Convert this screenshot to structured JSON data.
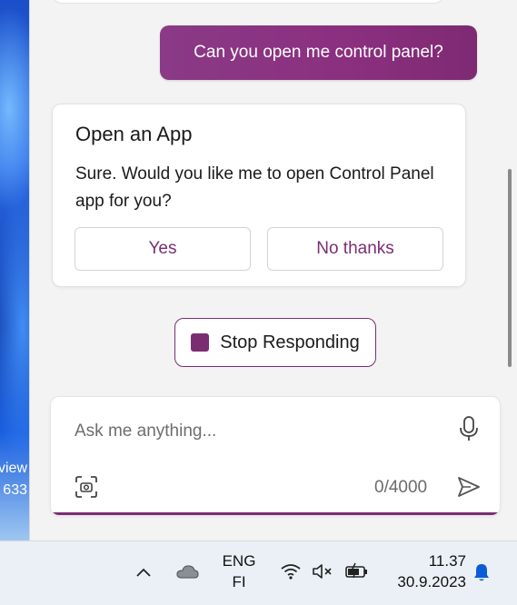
{
  "desktop": {
    "partial_text": [
      "view",
      "633"
    ]
  },
  "chat": {
    "user_message": "Can you open me control panel?",
    "card": {
      "title": "Open an App",
      "body": "Sure. Would you like me to open Control Panel app for you?",
      "yes_label": "Yes",
      "no_label": "No thanks"
    },
    "stop_label": "Stop Responding"
  },
  "composer": {
    "placeholder": "Ask me anything...",
    "char_count": "0/4000"
  },
  "taskbar": {
    "lang_line1": "ENG",
    "lang_line2": "FI",
    "time": "11.37",
    "date": "30.9.2023"
  },
  "colors": {
    "accent": "#7b2d72",
    "bubble": "#8a3a86",
    "panel_bg": "#f3f3f3",
    "taskbar_bg": "#eaf0f6",
    "notification": "#0b5cd6"
  },
  "icons": [
    "chevron-up-icon",
    "cloud-icon",
    "wifi-icon",
    "speaker-muted-icon",
    "battery-charging-icon",
    "bell-icon",
    "microphone-icon",
    "camera-scan-icon",
    "send-icon",
    "stop-icon"
  ]
}
